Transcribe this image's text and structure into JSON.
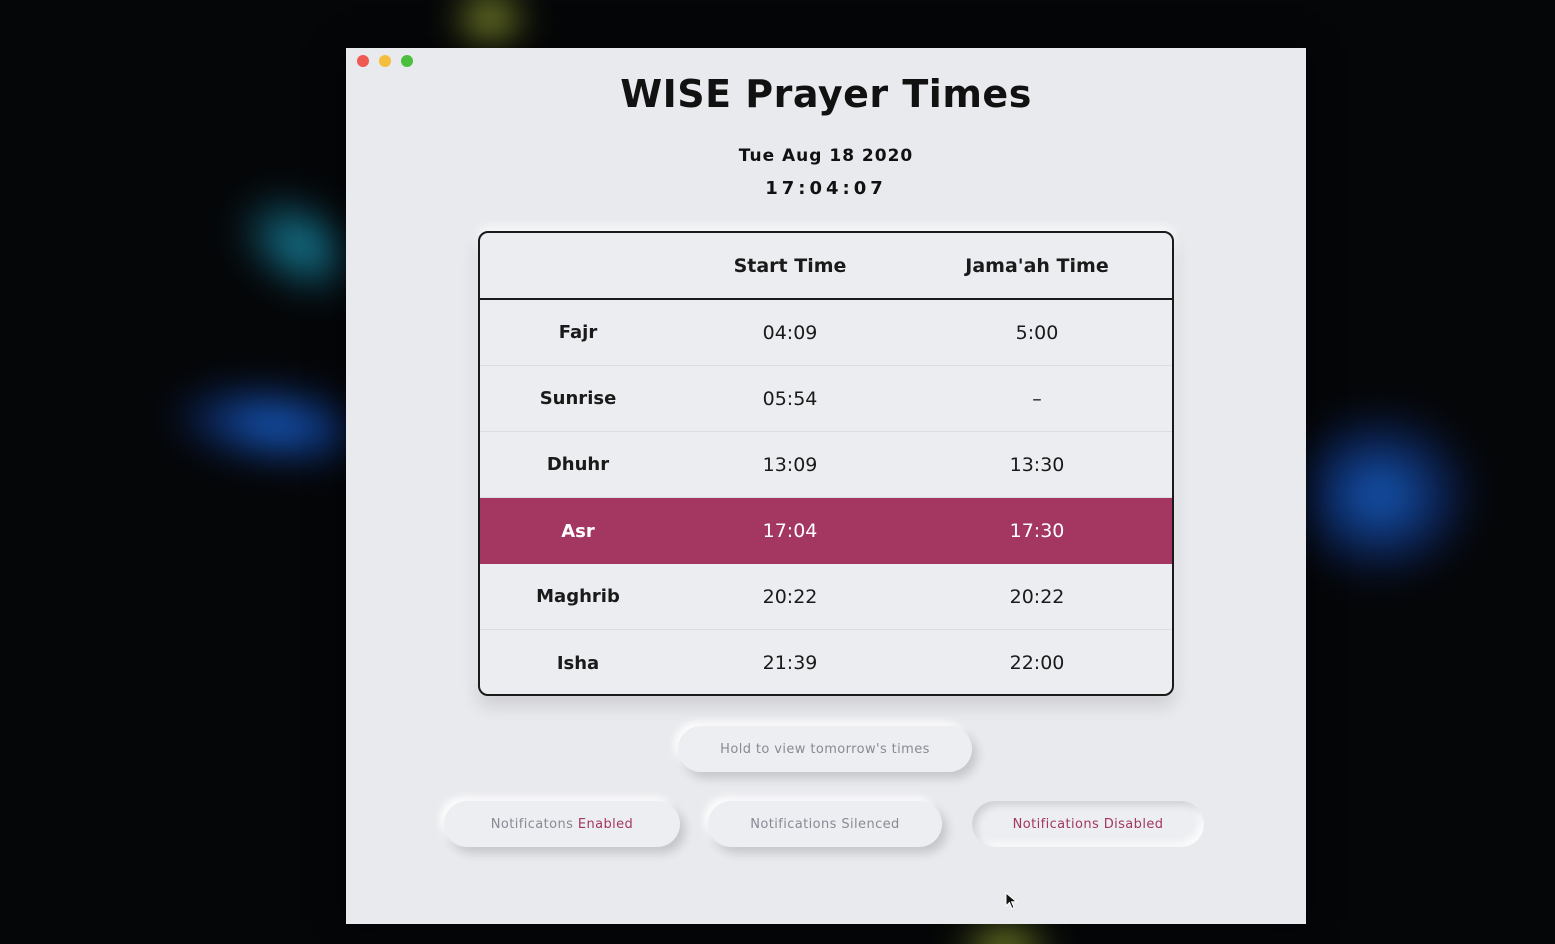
{
  "window": {
    "title": "WISE Prayer Times",
    "date": "Tue Aug 18 2020",
    "time": "17:04:07"
  },
  "table": {
    "columns": [
      "",
      "Start Time",
      "Jama'ah Time"
    ],
    "rows": [
      {
        "name": "Fajr",
        "start": "04:09",
        "jamaah": "5:00",
        "active": false
      },
      {
        "name": "Sunrise",
        "start": "05:54",
        "jamaah": "–",
        "active": false
      },
      {
        "name": "Dhuhr",
        "start": "13:09",
        "jamaah": "13:30",
        "active": false
      },
      {
        "name": "Asr",
        "start": "17:04",
        "jamaah": "17:30",
        "active": true
      },
      {
        "name": "Maghrib",
        "start": "20:22",
        "jamaah": "20:22",
        "active": false
      },
      {
        "name": "Isha",
        "start": "21:39",
        "jamaah": "22:00",
        "active": false
      }
    ]
  },
  "buttons": {
    "tomorrow": "Hold to view tomorrow's times",
    "enabled_prefix": "Notificatons ",
    "enabled_accent": "Enabled",
    "silenced": "Notifications Silenced",
    "disabled": "Notifications Disabled"
  },
  "colors": {
    "accent": "#a33762",
    "window_bg": "#e9eaee",
    "desktop_bg": "#050608"
  },
  "icons": {
    "close": "close-icon",
    "minimize": "minimize-icon",
    "zoom": "zoom-icon",
    "cursor": "mouse-cursor-icon"
  }
}
